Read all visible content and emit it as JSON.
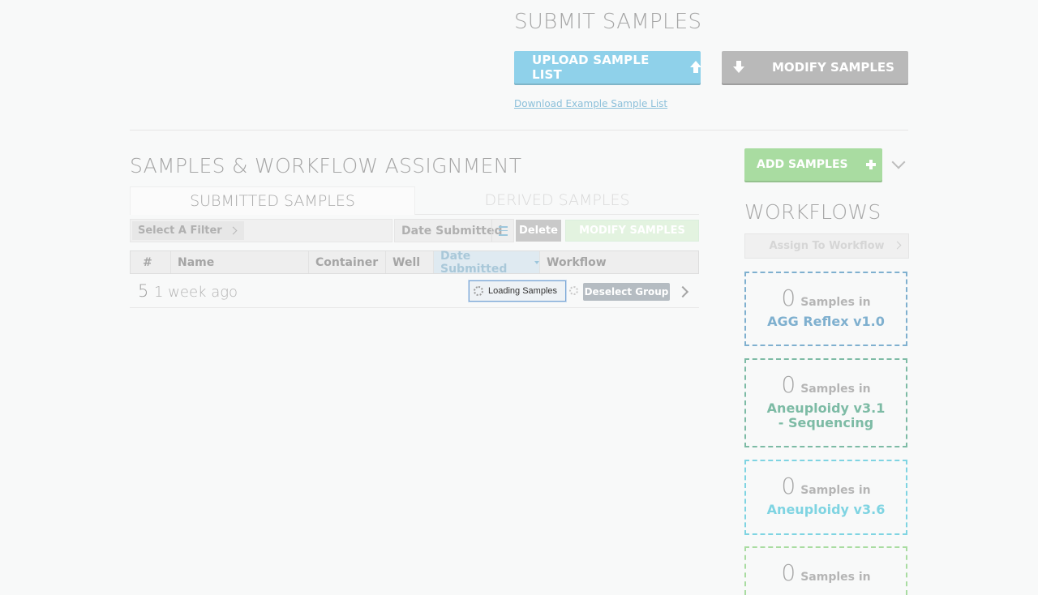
{
  "submit": {
    "title": "SUBMIT SAMPLES",
    "upload_label": "UPLOAD SAMPLE LIST",
    "modify_label": "MODIFY SAMPLES",
    "download_link": "Download Example Sample List"
  },
  "samples": {
    "title": "SAMPLES & WORKFLOW ASSIGNMENT",
    "tabs": [
      {
        "label": "SUBMITTED SAMPLES",
        "active": true
      },
      {
        "label": "DERIVED SAMPLES",
        "active": false
      }
    ],
    "filter_placeholder": "Select A Filter",
    "sort_by": "Date Submitted",
    "delete_label": "Delete",
    "modify_label": "MODIFY SAMPLES",
    "columns": [
      "#",
      "Name",
      "Container",
      "Well",
      "Date Submitted",
      "Workflow"
    ],
    "sorted_column": "Date Submitted",
    "group": {
      "count": "5",
      "when": "1 week ago",
      "loading_text": "Loading Samples",
      "deselect_label": "Deselect Group"
    }
  },
  "sidebar": {
    "add_label": "ADD SAMPLES",
    "workflows_title": "WORKFLOWS",
    "assign_placeholder": "Assign To Workflow",
    "samples_in_label": "Samples in",
    "workflows": [
      {
        "count": "0",
        "name": "AGG Reflex v1.0",
        "color": "#7fb0cf"
      },
      {
        "count": "0",
        "name": "Aneuploidy v3.1 - Sequencing",
        "color": "#7dbba5"
      },
      {
        "count": "0",
        "name": "Aneuploidy v3.6",
        "color": "#7fd4e2"
      },
      {
        "count": "0",
        "name": "",
        "color": "#a9dca1"
      }
    ]
  },
  "colors": {
    "upload_button": "#8fd1ea",
    "modify_button": "#b9b9b9",
    "add_button": "#a9dca1",
    "link": "#8cc0da"
  }
}
